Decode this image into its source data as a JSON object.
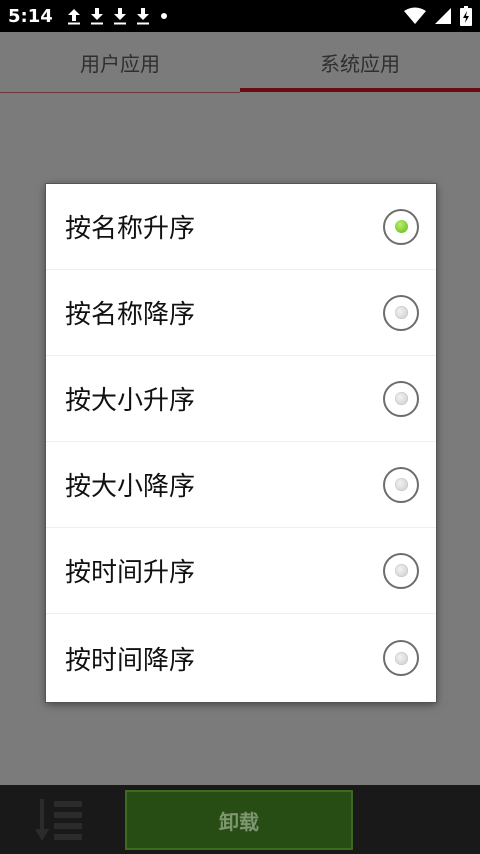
{
  "status_bar": {
    "time": "5:14",
    "notification_icons": [
      "upload-icon",
      "download-icon",
      "download-icon",
      "download-icon",
      "dot-icon"
    ],
    "right_icons": [
      "wifi-icon",
      "signal-icon",
      "battery-charging-icon"
    ]
  },
  "tabs": [
    {
      "label": "用户应用",
      "active": false
    },
    {
      "label": "系统应用",
      "active": true
    }
  ],
  "sort_dialog": {
    "options": [
      {
        "label": "按名称升序",
        "selected": true
      },
      {
        "label": "按名称降序",
        "selected": false
      },
      {
        "label": "按大小升序",
        "selected": false
      },
      {
        "label": "按大小降序",
        "selected": false
      },
      {
        "label": "按时间升序",
        "selected": false
      },
      {
        "label": "按时间降序",
        "selected": false
      }
    ]
  },
  "bottom_bar": {
    "sort_icon": "sort-icon",
    "uninstall_label": "卸载"
  },
  "colors": {
    "tab_indicator": "#6a0b14",
    "uninstall_button": "#274d14",
    "radio_selected": "#7ed321"
  }
}
